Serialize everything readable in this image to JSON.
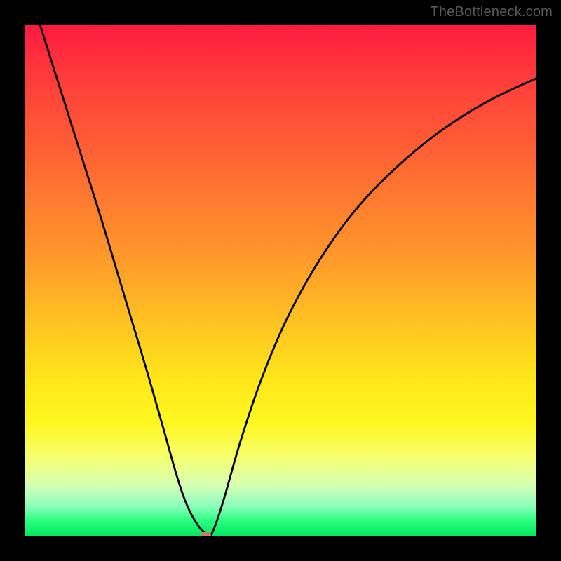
{
  "watermark": "TheBottleneck.com",
  "chart_data": {
    "type": "line",
    "title": "",
    "xlabel": "",
    "ylabel": "",
    "xlim": [
      0,
      1
    ],
    "ylim": [
      0,
      1
    ],
    "series": [
      {
        "name": "curve",
        "x": [
          0.03,
          0.06,
          0.09,
          0.12,
          0.15,
          0.18,
          0.21,
          0.24,
          0.27,
          0.3,
          0.32,
          0.34,
          0.355,
          0.36,
          0.37,
          0.39,
          0.42,
          0.46,
          0.51,
          0.57,
          0.64,
          0.72,
          0.81,
          0.905,
          1.0
        ],
        "y": [
          1.0,
          0.905,
          0.81,
          0.715,
          0.62,
          0.52,
          0.42,
          0.32,
          0.215,
          0.11,
          0.055,
          0.02,
          0.005,
          0.0,
          0.015,
          0.075,
          0.18,
          0.3,
          0.42,
          0.53,
          0.63,
          0.715,
          0.79,
          0.85,
          0.895
        ]
      }
    ],
    "marker": {
      "x": 0.355,
      "y": 0.003
    },
    "gradient_colors": [
      "#ff1a40",
      "#ffd21e",
      "#00e660"
    ]
  }
}
